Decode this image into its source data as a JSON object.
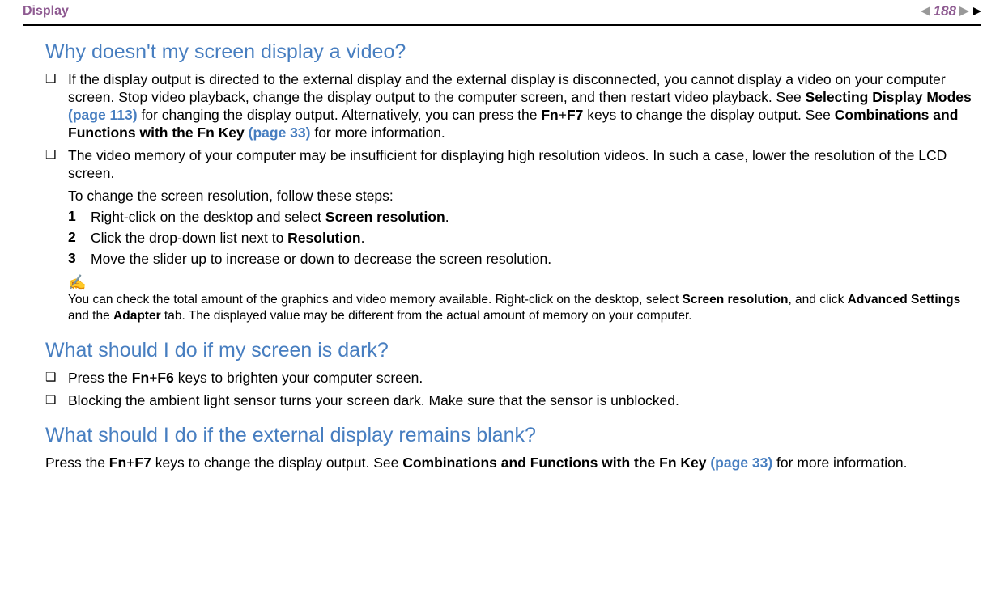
{
  "header": {
    "doc_title": "Display",
    "page_number": "188"
  },
  "sections": [
    {
      "heading": "Why doesn't my screen display a video?",
      "bullets": [
        {
          "text_before": "If the display output is directed to the external display and the external display is disconnected, you cannot display a video on your computer screen. Stop video playback, change the display output to the computer screen, and then restart video playback. See ",
          "bold1": "Selecting Display Modes ",
          "link1": "(page 113)",
          "mid1": " for changing the display output. Alternatively, you can press the ",
          "bold2": "Fn",
          "plus1": "+",
          "bold3": "F7",
          "mid2": " keys to change the display output. See ",
          "bold4": "Combinations and Functions with the Fn Key ",
          "link2": "(page 33)",
          "tail": " for more information."
        },
        {
          "text_before": "The video memory of your computer may be insufficient for displaying high resolution videos. In such a case, lower the resolution of the LCD screen."
        }
      ],
      "sub_para": "To change the screen resolution, follow these steps:",
      "steps": [
        {
          "num": "1",
          "pre": "Right-click on the desktop and select ",
          "b": "Screen resolution",
          "post": "."
        },
        {
          "num": "2",
          "pre": "Click the drop-down list next to ",
          "b": "Resolution",
          "post": "."
        },
        {
          "num": "3",
          "pre": "Move the slider up to increase or down to decrease the screen resolution.",
          "b": "",
          "post": ""
        }
      ],
      "note": {
        "icon": "✍",
        "pre": "You can check the total amount of the graphics and video memory available. Right-click on the desktop, select ",
        "b1": "Screen resolution",
        "mid1": ", and click ",
        "b2": "Advanced Settings",
        "mid2": " and the ",
        "b3": "Adapter",
        "post": " tab. The displayed value may be different from the actual amount of memory on your computer."
      }
    },
    {
      "heading": "What should I do if my screen is dark?",
      "bullets": [
        {
          "text_before": "Press the ",
          "bold2": "Fn",
          "plus1": "+",
          "bold3": "F6",
          "mid2": " keys to brighten your computer screen."
        },
        {
          "text_before": "Blocking the ambient light sensor turns your screen dark. Make sure that the sensor is unblocked."
        }
      ]
    },
    {
      "heading": "What should I do if the external display remains blank?",
      "para": {
        "pre": "Press the ",
        "b1": "Fn",
        "plus": "+",
        "b2": "F7",
        "mid": " keys to change the display output. See ",
        "b3": "Combinations and Functions with the Fn Key ",
        "link": "(page 33)",
        "post": " for more information."
      }
    }
  ]
}
